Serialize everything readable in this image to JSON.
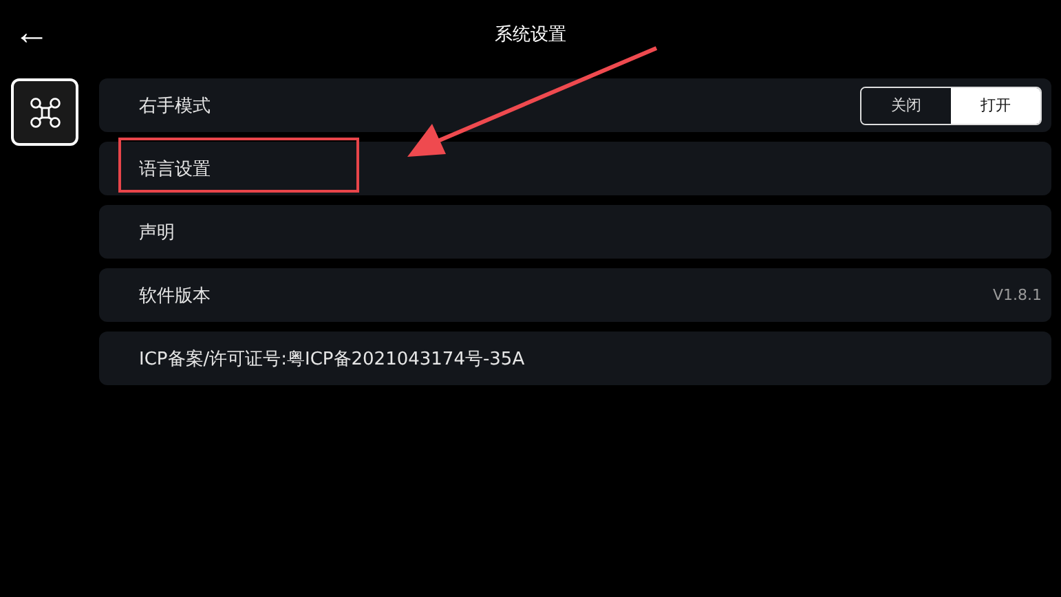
{
  "header": {
    "back": "←",
    "title": "系统设置"
  },
  "sidebar": {
    "items": [
      {
        "kind": "drone",
        "selected": true
      }
    ]
  },
  "rows": [
    {
      "kind": "toggle",
      "label": "右手模式",
      "annotated": false,
      "options": [
        {
          "label": "关闭",
          "selected": false
        },
        {
          "label": "打开",
          "selected": true
        }
      ]
    },
    {
      "kind": "plain",
      "label": "语言设置",
      "annotated": true
    },
    {
      "kind": "plain",
      "label": "声明",
      "annotated": false
    },
    {
      "kind": "value",
      "label": "软件版本",
      "value": "V1.8.1",
      "annotated": false
    },
    {
      "kind": "plain",
      "label": "ICP备案/许可证号:粤ICP备2021043174号-35A",
      "annotated": false
    }
  ]
}
